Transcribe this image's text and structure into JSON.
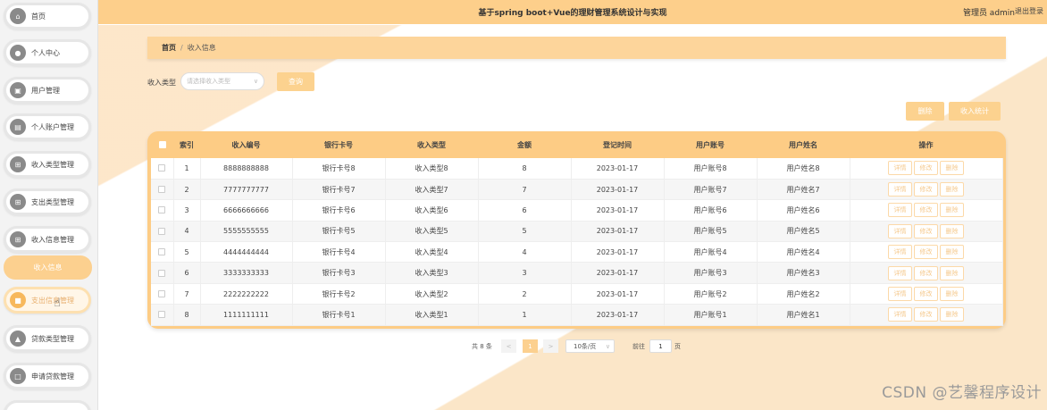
{
  "header": {
    "title": "基于spring boot+Vue的理财管理系统设计与实现",
    "user": "管理员 admin",
    "logout": "退出登录"
  },
  "sidebar": {
    "items": [
      {
        "label": "首页",
        "icon": "home-icon"
      },
      {
        "label": "个人中心",
        "icon": "user-icon"
      },
      {
        "label": "用户管理",
        "icon": "id-card-icon"
      },
      {
        "label": "个人账户管理",
        "icon": "wallet-icon"
      },
      {
        "label": "收入类型管理",
        "icon": "grid-icon"
      },
      {
        "label": "支出类型管理",
        "icon": "grid-icon"
      },
      {
        "label": "收入信息管理",
        "icon": "grid-icon"
      },
      {
        "label": "支出信息管理",
        "icon": "folder-icon"
      },
      {
        "label": "贷款类型管理",
        "icon": "thumbs-up-icon"
      },
      {
        "label": "申请贷款管理",
        "icon": "document-icon"
      }
    ],
    "sub_item": "收入信息"
  },
  "breadcrumb": {
    "home": "首页",
    "separator": "/",
    "current": "收入信息"
  },
  "search": {
    "label": "收入类型",
    "placeholder": "请选择收入类型",
    "button": "查询"
  },
  "actions": {
    "delete": "删除",
    "stats": "收入统计"
  },
  "table": {
    "headers": [
      "索引",
      "收入编号",
      "银行卡号",
      "收入类型",
      "金额",
      "登记时间",
      "用户账号",
      "用户姓名",
      "操作"
    ],
    "op_labels": [
      "详情",
      "修改",
      "删除"
    ],
    "rows": [
      {
        "idx": "1",
        "code": "8888888888",
        "card": "银行卡号8",
        "type": "收入类型8",
        "amount": "8",
        "time": "2023-01-17",
        "account": "用户账号8",
        "name": "用户姓名8"
      },
      {
        "idx": "2",
        "code": "7777777777",
        "card": "银行卡号7",
        "type": "收入类型7",
        "amount": "7",
        "time": "2023-01-17",
        "account": "用户账号7",
        "name": "用户姓名7"
      },
      {
        "idx": "3",
        "code": "6666666666",
        "card": "银行卡号6",
        "type": "收入类型6",
        "amount": "6",
        "time": "2023-01-17",
        "account": "用户账号6",
        "name": "用户姓名6"
      },
      {
        "idx": "4",
        "code": "5555555555",
        "card": "银行卡号5",
        "type": "收入类型5",
        "amount": "5",
        "time": "2023-01-17",
        "account": "用户账号5",
        "name": "用户姓名5"
      },
      {
        "idx": "5",
        "code": "4444444444",
        "card": "银行卡号4",
        "type": "收入类型4",
        "amount": "4",
        "time": "2023-01-17",
        "account": "用户账号4",
        "name": "用户姓名4"
      },
      {
        "idx": "6",
        "code": "3333333333",
        "card": "银行卡号3",
        "type": "收入类型3",
        "amount": "3",
        "time": "2023-01-17",
        "account": "用户账号3",
        "name": "用户姓名3"
      },
      {
        "idx": "7",
        "code": "2222222222",
        "card": "银行卡号2",
        "type": "收入类型2",
        "amount": "2",
        "time": "2023-01-17",
        "account": "用户账号2",
        "name": "用户姓名2"
      },
      {
        "idx": "8",
        "code": "1111111111",
        "card": "银行卡号1",
        "type": "收入类型1",
        "amount": "1",
        "time": "2023-01-17",
        "account": "用户账号1",
        "name": "用户姓名1"
      }
    ]
  },
  "pagination": {
    "total": "共 8 条",
    "prev": "<",
    "current_page": "1",
    "next": ">",
    "page_size": "10条/页",
    "goto_label": "前往",
    "goto_value": "1",
    "page_suffix": "页"
  },
  "watermark": "CSDN @艺馨程序设计",
  "colors": {
    "accent": "#fdcf8b",
    "button": "#fcd28f",
    "table_frame": "#fdcc85"
  }
}
